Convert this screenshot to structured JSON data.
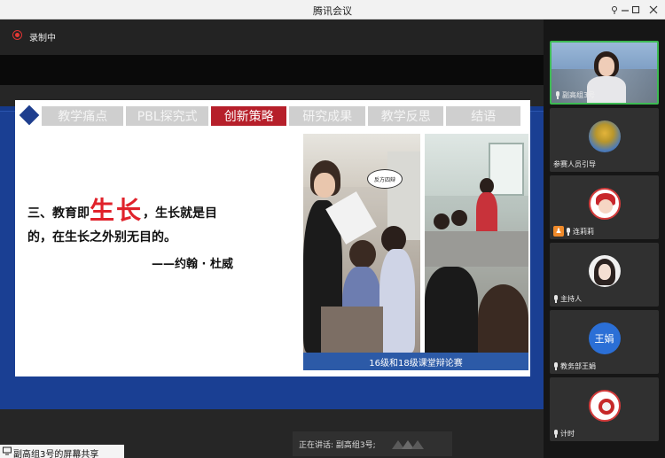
{
  "window": {
    "title": "腾讯会议",
    "minimize_icon": "minimize-icon",
    "maximize_icon": "maximize-icon",
    "close_icon": "close-icon"
  },
  "recording": {
    "label": "录制中"
  },
  "slide": {
    "tabs": [
      {
        "label": "教学痛点",
        "active": false
      },
      {
        "label": "PBL探究式",
        "active": false
      },
      {
        "label": "创新策略",
        "active": true
      },
      {
        "label": "研究成果",
        "active": false
      },
      {
        "label": "教学反思",
        "active": false
      },
      {
        "label": "结语",
        "active": false
      }
    ],
    "quote_prefix": "三、教育即",
    "quote_highlight": "生长",
    "quote_suffix": "，生长就是目",
    "quote_line2": "的，在生长之外别无目的。",
    "author": "——约翰 · 杜威",
    "photo_bubble_text": "反方四辩",
    "caption": "16级和18级课堂辩论赛",
    "accent_color": "#b61f2a",
    "highlight_color": "#e0222b",
    "frame_color": "#1a3f93"
  },
  "speaking": {
    "label": "正在讲话: 副高组3号;"
  },
  "share": {
    "label": "副高组3号的屏幕共享"
  },
  "participants": [
    {
      "name": "副高组3号",
      "active": true,
      "avatar": "video-feed"
    },
    {
      "name": "参赛人员引导",
      "active": false,
      "avatar": "landscape-avatar"
    },
    {
      "name": "连莉莉",
      "active": false,
      "avatar": "cartoon-avatar",
      "host": true
    },
    {
      "name": "主持人",
      "active": false,
      "avatar": "photo-avatar"
    },
    {
      "name": "教务部王娟",
      "active": false,
      "avatar": "text-avatar",
      "avatar_text": "王娟"
    },
    {
      "name": "计时",
      "active": false,
      "avatar": "logo-avatar"
    }
  ]
}
